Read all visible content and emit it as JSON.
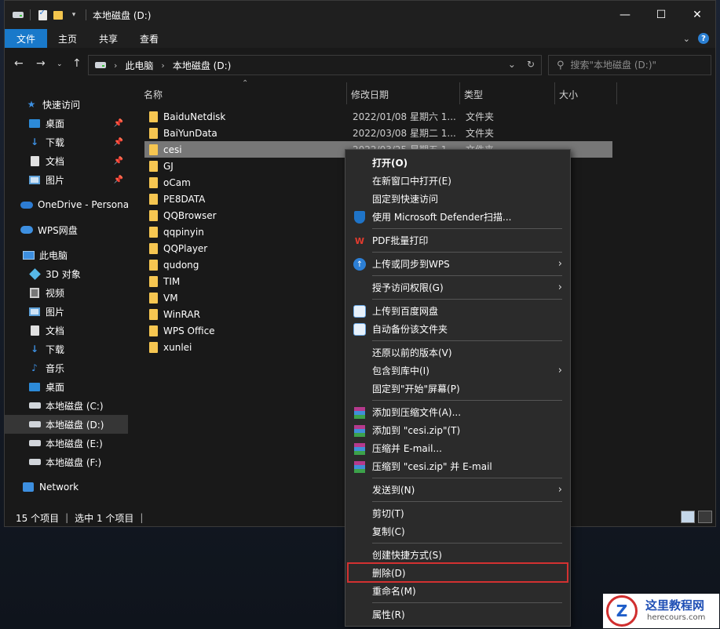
{
  "window": {
    "title": "本地磁盘 (D:)",
    "controls": {
      "minimize": "—",
      "maximize": "☐",
      "close": "✕"
    }
  },
  "ribbon": {
    "tabs": [
      "文件",
      "主页",
      "共享",
      "查看"
    ]
  },
  "address": {
    "crumbs": [
      "此电脑",
      "本地磁盘 (D:)"
    ],
    "search_placeholder": "搜索\"本地磁盘 (D:)\""
  },
  "nav": {
    "items": [
      {
        "label": "快速访问",
        "icon": "star-icon"
      },
      {
        "label": "桌面",
        "icon": "desktop-icon",
        "pinned": true
      },
      {
        "label": "下载",
        "icon": "download-icon",
        "pinned": true
      },
      {
        "label": "文档",
        "icon": "document-icon",
        "pinned": true
      },
      {
        "label": "图片",
        "icon": "picture-icon",
        "pinned": true
      },
      {
        "label": "OneDrive - Persona",
        "icon": "onedrive-icon"
      },
      {
        "label": "WPS网盘",
        "icon": "wps-cloud-icon"
      },
      {
        "label": "此电脑",
        "icon": "pc-icon"
      },
      {
        "label": "3D 对象",
        "icon": "3d-objects-icon"
      },
      {
        "label": "视频",
        "icon": "video-icon"
      },
      {
        "label": "图片",
        "icon": "picture-icon"
      },
      {
        "label": "文档",
        "icon": "document-icon"
      },
      {
        "label": "下载",
        "icon": "download-icon"
      },
      {
        "label": "音乐",
        "icon": "music-icon"
      },
      {
        "label": "桌面",
        "icon": "desktop-icon"
      },
      {
        "label": "本地磁盘 (C:)",
        "icon": "drive-icon"
      },
      {
        "label": "本地磁盘 (D:)",
        "icon": "drive-icon",
        "selected": true
      },
      {
        "label": "本地磁盘 (E:)",
        "icon": "drive-icon"
      },
      {
        "label": "本地磁盘 (F:)",
        "icon": "drive-icon"
      },
      {
        "label": "Network",
        "icon": "network-icon"
      }
    ]
  },
  "columns": {
    "name": "名称",
    "date": "修改日期",
    "type": "类型",
    "size": "大小"
  },
  "files": [
    {
      "name": "BaiduNetdisk",
      "date": "2022/01/08 星期六 1...",
      "type": "文件夹"
    },
    {
      "name": "BaiYunData",
      "date": "2022/03/08 星期二 1...",
      "type": "文件夹"
    },
    {
      "name": "cesi",
      "date": "2022/03/25 星期五 1...",
      "type": "文件夹",
      "selected": true
    },
    {
      "name": "GJ",
      "date": "",
      "type": ""
    },
    {
      "name": "oCam",
      "date": "",
      "type": ""
    },
    {
      "name": "PE8DATA",
      "date": "",
      "type": ""
    },
    {
      "name": "QQBrowser",
      "date": "",
      "type": ""
    },
    {
      "name": "qqpinyin",
      "date": "",
      "type": ""
    },
    {
      "name": "QQPlayer",
      "date": "",
      "type": ""
    },
    {
      "name": "qudong",
      "date": "",
      "type": ""
    },
    {
      "name": "TIM",
      "date": "",
      "type": ""
    },
    {
      "name": "VM",
      "date": "",
      "type": ""
    },
    {
      "name": "WinRAR",
      "date": "",
      "type": ""
    },
    {
      "name": "WPS Office",
      "date": "",
      "type": ""
    },
    {
      "name": "xunlei",
      "date": "",
      "type": ""
    }
  ],
  "status": {
    "count": "15 个项目",
    "selected": "选中 1 个项目"
  },
  "context_menu": {
    "items": [
      {
        "label": "打开(O)",
        "bold": true
      },
      {
        "label": "在新窗口中打开(E)"
      },
      {
        "label": "固定到快速访问"
      },
      {
        "label": "使用 Microsoft Defender扫描...",
        "icon": "defender-shield-icon"
      },
      {
        "label": "PDF批量打印",
        "icon": "wps-pdf-icon"
      },
      {
        "label": "上传或同步到WPS",
        "icon": "wps-upload-icon",
        "submenu": true
      },
      {
        "label": "授予访问权限(G)",
        "submenu": true
      },
      {
        "label": "上传到百度网盘",
        "icon": "baidu-netdisk-icon"
      },
      {
        "label": "自动备份该文件夹",
        "icon": "baidu-netdisk-icon"
      },
      {
        "label": "还原以前的版本(V)"
      },
      {
        "label": "包含到库中(I)",
        "submenu": true
      },
      {
        "label": "固定到\"开始\"屏幕(P)"
      },
      {
        "label": "添加到压缩文件(A)...",
        "icon": "winrar-icon"
      },
      {
        "label": "添加到 \"cesi.zip\"(T)",
        "icon": "winrar-icon"
      },
      {
        "label": "压缩并 E-mail...",
        "icon": "winrar-icon"
      },
      {
        "label": "压缩到 \"cesi.zip\" 并 E-mail",
        "icon": "winrar-icon"
      },
      {
        "label": "发送到(N)",
        "submenu": true
      },
      {
        "label": "剪切(T)"
      },
      {
        "label": "复制(C)"
      },
      {
        "label": "创建快捷方式(S)"
      },
      {
        "label": "删除(D)",
        "highlighted": true
      },
      {
        "label": "重命名(M)"
      },
      {
        "label": "属性(R)"
      }
    ]
  },
  "watermark": {
    "title": "这里教程网",
    "url": "herecours.com"
  },
  "colors": {
    "accent": "#1979ca",
    "highlight_box": "#d33131",
    "folder": "#f6c651"
  }
}
